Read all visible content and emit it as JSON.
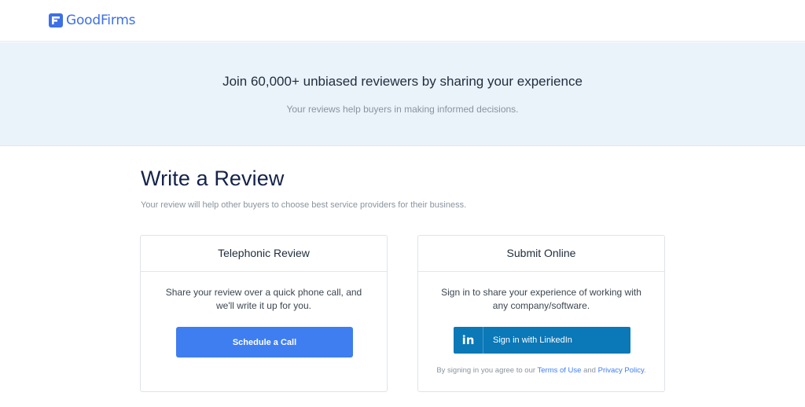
{
  "brand": {
    "name": "GoodFirms",
    "color": "#3d6fe8"
  },
  "hero": {
    "title": "Join 60,000+ unbiased reviewers by sharing your experience",
    "subtitle": "Your reviews help buyers in making informed decisions."
  },
  "page": {
    "title": "Write a Review",
    "subtitle": "Your review will help other buyers to choose best service providers for their business."
  },
  "cards": {
    "telephonic": {
      "title": "Telephonic Review",
      "description": "Share your review over a quick phone call, and we'll write it up for you.",
      "button_label": "Schedule a Call"
    },
    "online": {
      "title": "Submit Online",
      "description": "Sign in to share your experience of working with any company/software.",
      "button_icon": "in",
      "button_label": "Sign in with LinkedIn",
      "legal_prefix": "By signing in you agree to our",
      "terms_label": "Terms of Use",
      "legal_and": "and",
      "privacy_label": "Privacy Policy",
      "legal_suffix": "."
    }
  },
  "colors": {
    "accent": "#3e7ef0",
    "linkedin": "#0b78b8",
    "hero_bg": "#eaf2fa"
  }
}
